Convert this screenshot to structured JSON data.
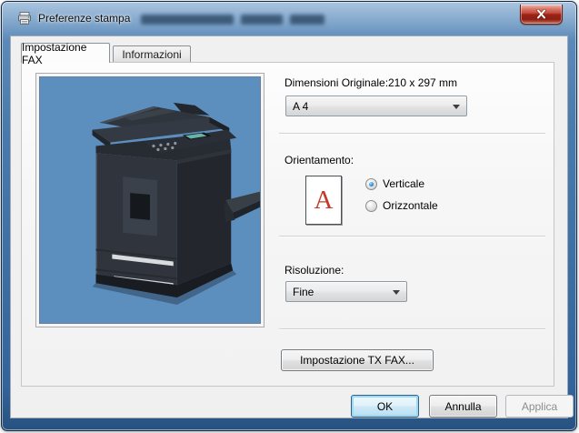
{
  "window": {
    "title": "Preferenze stampa"
  },
  "tabs": [
    {
      "label": "Impostazione FAX",
      "active": true
    },
    {
      "label": "Informazioni",
      "active": false
    }
  ],
  "content": {
    "original_size": {
      "label": "Dimensioni Originale:",
      "value": "210 x 297 mm",
      "selected_option": "A 4"
    },
    "orientation": {
      "label": "Orientamento:",
      "icon_letter": "A",
      "options": [
        {
          "label": "Verticale",
          "selected": true
        },
        {
          "label": "Orizzontale",
          "selected": false
        }
      ]
    },
    "resolution": {
      "label": "Risoluzione:",
      "selected_option": "Fine"
    },
    "tx_fax_button_label": "Impostazione TX FAX..."
  },
  "footer": {
    "ok_label": "OK",
    "cancel_label": "Annulla",
    "apply_label": "Applica",
    "apply_enabled": false
  },
  "colors": {
    "preview_background": "#5C8EBE",
    "titlebar_glass": "#4779AC",
    "close_button_red": "#BC4537",
    "default_button_glow": "#9ED9F2",
    "orientation_letter_red": "#C33A2A"
  }
}
